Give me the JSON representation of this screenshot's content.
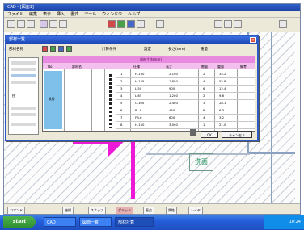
{
  "app": {
    "title": "CAD - [図面1]",
    "menu": [
      "ファイル",
      "編集",
      "表示",
      "挿入",
      "書式",
      "ツール",
      "ウィンドウ",
      "ヘルプ"
    ]
  },
  "dialog": {
    "title": "部材一覧",
    "close_label": "×",
    "top_labels": [
      "部材名称",
      "計算条件",
      "設定",
      "長さ(mm)",
      "重量"
    ],
    "group_header": "部材寸法(mm)",
    "columns": [
      "No",
      "部材名",
      "仕様",
      "長さ",
      "数量",
      "重量",
      "備考"
    ],
    "blue_cell": "鉄骨",
    "left_cell": "柱",
    "rows": [
      {
        "no": "1",
        "spec": "H-100",
        "len": "2,100",
        "qty": "2",
        "w": "34.2"
      },
      {
        "no": "2",
        "spec": "H-125",
        "len": "1,850",
        "qty": "4",
        "w": "52.8"
      },
      {
        "no": "3",
        "spec": "L-50",
        "len": "900",
        "qty": "6",
        "w": "12.4"
      },
      {
        "no": "4",
        "spec": "L-65",
        "len": "1,200",
        "qty": "2",
        "w": "9.6"
      },
      {
        "no": "5",
        "spec": "C-100",
        "len": "2,400",
        "qty": "3",
        "w": "28.1"
      },
      {
        "no": "6",
        "spec": "PL-9",
        "len": "450",
        "qty": "8",
        "w": "6.3"
      },
      {
        "no": "7",
        "spec": "FB-6",
        "len": "600",
        "qty": "4",
        "w": "3.2"
      },
      {
        "no": "8",
        "spec": "H-150",
        "len": "3,000",
        "qty": "1",
        "w": "21.0"
      }
    ],
    "ok_label": "OK",
    "cancel_label": "キャンセル"
  },
  "canvas": {
    "room_label": "洗面"
  },
  "command_bar": [
    "コマンド",
    "座標",
    "スナップ",
    "グリッド",
    "直交",
    "属性",
    "レイヤ"
  ],
  "taskbar": {
    "start_label": "start",
    "tasks": [
      "CAD",
      "図面一覧",
      "部材計算"
    ],
    "clock": "10:24"
  },
  "colors": {
    "accent_pink": "#ee18d8",
    "header_pink": "#e88ae0",
    "cell_blue": "#7ec0ea",
    "title_blue": "#2c5bc4"
  }
}
